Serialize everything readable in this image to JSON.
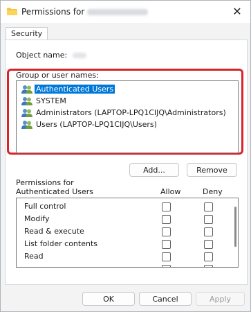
{
  "window": {
    "title_prefix": "Permissions for",
    "close_glyph": "✕"
  },
  "tabs": [
    {
      "label": "Security"
    }
  ],
  "object": {
    "label": "Object name:"
  },
  "group": {
    "label": "Group or user names:",
    "users": [
      {
        "name": "Authenticated Users",
        "selected": true
      },
      {
        "name": "SYSTEM",
        "selected": false
      },
      {
        "name": "Administrators (LAPTOP-LPQ1CIJQ\\Administrators)",
        "selected": false
      },
      {
        "name": "Users (LAPTOP-LPQ1CIJQ\\Users)",
        "selected": false
      }
    ],
    "add_label": "Add...",
    "remove_label": "Remove"
  },
  "permissions": {
    "label": "Permissions for Authenticated Users",
    "allow_label": "Allow",
    "deny_label": "Deny",
    "rows": [
      {
        "name": "Full control",
        "allow": false,
        "deny": false
      },
      {
        "name": "Modify",
        "allow": false,
        "deny": false
      },
      {
        "name": "Read & execute",
        "allow": false,
        "deny": false
      },
      {
        "name": "List folder contents",
        "allow": false,
        "deny": false
      },
      {
        "name": "Read",
        "allow": false,
        "deny": false
      }
    ]
  },
  "footer": {
    "ok_label": "OK",
    "cancel_label": "Cancel",
    "apply_label": "Apply"
  },
  "colors": {
    "highlight_border": "#d9222a",
    "selection": "#0078d7"
  },
  "icons": {
    "title": "folder-icon",
    "user": "users-group-icon",
    "close": "close-icon"
  }
}
